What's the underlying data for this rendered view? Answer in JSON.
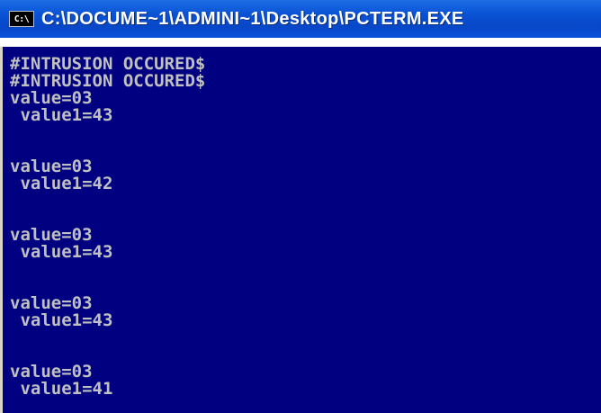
{
  "window": {
    "title": "C:\\DOCUME~1\\ADMINI~1\\Desktop\\PCTERM.EXE",
    "icon_label": "C:\\"
  },
  "console": {
    "lines": [
      "#INTRUSION OCCURED$",
      "#INTRUSION OCCURED$",
      "value=03",
      " value1=43",
      "",
      "",
      "value=03",
      " value1=42",
      "",
      "",
      "value=03",
      " value1=43",
      "",
      "",
      "value=03",
      " value1=43",
      "",
      "",
      "value=03",
      " value1=41"
    ]
  },
  "colors": {
    "titlebar": "#0a54d6",
    "console_background": "#000080",
    "console_text": "#c0c0c0"
  }
}
